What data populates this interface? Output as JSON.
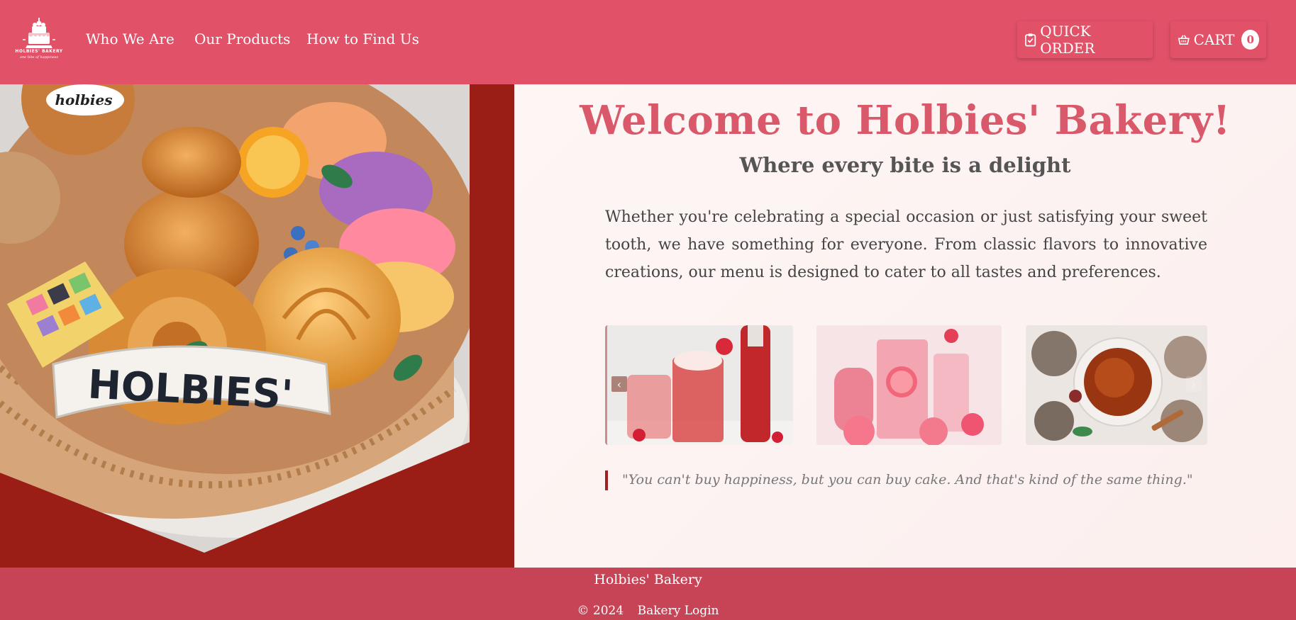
{
  "header": {
    "logo": {
      "brand": "HOLBIES' BAKERY",
      "tagline": "one bite of happiness"
    },
    "nav": [
      {
        "label": "Who We Are"
      },
      {
        "label": "Our Products"
      },
      {
        "label": "How to Find Us"
      }
    ],
    "quick_order": {
      "label": "QUICK ORDER",
      "icon": "clipboard-icon"
    },
    "cart": {
      "label": "CART",
      "count": "0",
      "icon": "basket-icon"
    },
    "color": "#e15168"
  },
  "hero_image": {
    "label": "HOLBIES'",
    "brand_tag": "holbies",
    "background": "#9b1e16"
  },
  "main": {
    "title": "Welcome to Holbies' Bakery!",
    "subtitle": "Where every bite is a delight",
    "intro": "Whether you're celebrating a special occasion or just satisfying your sweet tooth, we have something for everyone. From classic flavors to innovative creations, our menu is designed to cater to all tastes and preferences.",
    "carousel": {
      "slides": [
        {
          "icon": "red-drinks-image"
        },
        {
          "icon": "grapefruit-drinks-image"
        },
        {
          "icon": "tea-spices-image"
        }
      ],
      "prev": "‹",
      "next": "›"
    },
    "quote": "\"You can't buy happiness, but you can buy cake. And that's kind of the same thing.\""
  },
  "footer": {
    "title": "Holbies' Bakery",
    "copyright": "© 2024",
    "login": "Bakery Login",
    "color": "#c64456"
  }
}
